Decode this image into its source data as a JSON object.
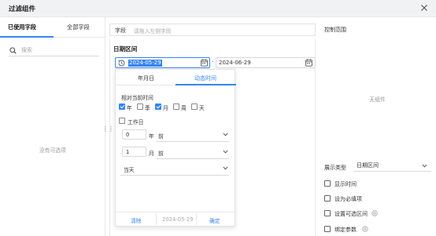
{
  "dialog": {
    "title": "过滤组件"
  },
  "left": {
    "tabs": [
      {
        "label": "已使用字段",
        "active": true
      },
      {
        "label": "全部字段",
        "active": false
      }
    ],
    "search_placeholder": "搜索",
    "empty_text": "没有可选项"
  },
  "field": {
    "label": "字段",
    "placeholder": "请拖入左侧字段"
  },
  "date_section": {
    "title": "日期区间",
    "start": "2024-05-29",
    "end": "2024-06-29"
  },
  "picker": {
    "tabs": [
      {
        "label": "年月日",
        "active": false
      },
      {
        "label": "动态时间",
        "active": true
      }
    ],
    "relative_label": "相对当前时间",
    "units": [
      {
        "label": "年",
        "checked": true
      },
      {
        "label": "季",
        "checked": false
      },
      {
        "label": "月",
        "checked": true
      },
      {
        "label": "周",
        "checked": false
      },
      {
        "label": "天",
        "checked": false
      }
    ],
    "workday": {
      "label": "工作日",
      "checked": false
    },
    "year_row": {
      "value": "0",
      "unit": "年",
      "direction": "前"
    },
    "month_row": {
      "value": "1",
      "unit": "月",
      "direction": "前"
    },
    "day_select": "当天",
    "footer": {
      "clear": "清除",
      "preview": "2024-05-29",
      "confirm": "确定"
    }
  },
  "right": {
    "title": "控制范围",
    "empty_text": "无组件",
    "display_type_label": "展示类型",
    "display_type_value": "日期区间",
    "options": [
      {
        "label": "显示时间",
        "info": false
      },
      {
        "label": "设为必填项",
        "info": false
      },
      {
        "label": "设置可选区间",
        "info": true
      },
      {
        "label": "绑定参数",
        "info": true
      }
    ]
  },
  "colors": {
    "accent": "#3685f2",
    "header_bg": "#f1f2f4",
    "muted_text": "#999999"
  }
}
